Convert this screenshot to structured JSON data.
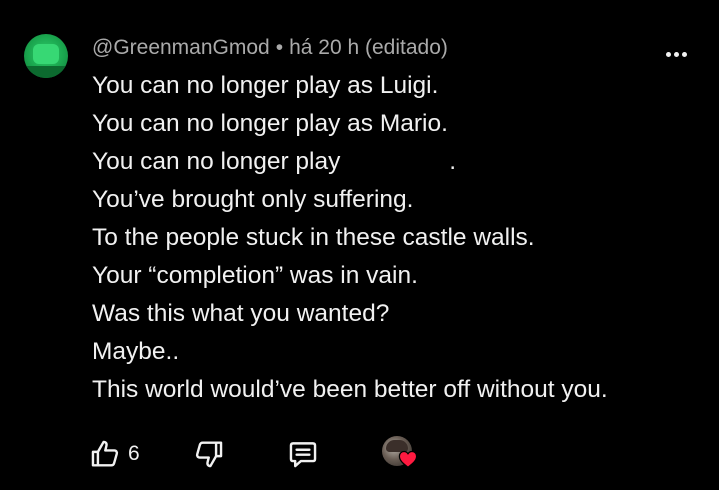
{
  "comment": {
    "author": "@GreenmanGmod",
    "separator": "•",
    "time": "há 20 h (editado)",
    "lines": [
      "You can no longer play as Luigi.",
      "You can no longer play as Mario.",
      "You can no longer play                .",
      "You’ve brought only suffering.",
      "To the people stuck in these castle walls.",
      "Your “completion” was in vain.",
      "Was this what you wanted?",
      "Maybe..",
      "This world would’ve been better off without you."
    ]
  },
  "actions": {
    "like_count": "6",
    "icons": [
      "thumbs-up-icon",
      "thumbs-down-icon",
      "reply-icon",
      "creator-heart-icon",
      "more-vertical-icon"
    ]
  },
  "colors": {
    "background": "#000000",
    "text": "#f1f1f1",
    "meta": "#aaaaaa",
    "heart": "#ff1a40"
  }
}
